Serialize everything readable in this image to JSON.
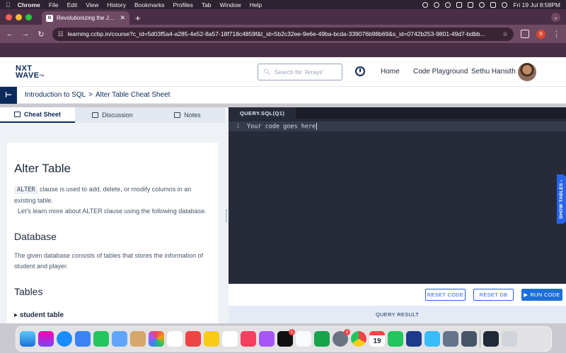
{
  "menubar": {
    "app": "Chrome",
    "items": [
      "File",
      "Edit",
      "View",
      "History",
      "Bookmarks",
      "Profiles",
      "Tab",
      "Window",
      "Help"
    ],
    "clock": "Fri 19 Jul  8:58PM"
  },
  "browser": {
    "tab_title": "Revolutionizing the Job Mark",
    "url": "learning.ccbp.in/course?c_id=5d03f5a4-a285-4e52-8a57-18f718c4859f&t_id=5b2c32ee-9e6e-49ba-bcda-339076b98b69&s_id=0742b253-9801-49d7-bdbb...",
    "profile_initial": "S"
  },
  "header": {
    "logo_line1": "NXT",
    "logo_line2": "WAVE",
    "logo_tm": "TM",
    "search_placeholder": "Search for 'Arrays'",
    "nav_home": "Home",
    "nav_playground": "Code Playground",
    "user_name": "Sethu Hansith"
  },
  "breadcrumb": {
    "course": "Introduction to SQL",
    "separator": ">",
    "page": "Alter Table Cheat Sheet"
  },
  "panel_tabs": [
    {
      "label": "Cheat Sheet",
      "icon": "book-icon"
    },
    {
      "label": "Discussion",
      "icon": "chat-icon"
    },
    {
      "label": "Notes",
      "icon": "notes-icon"
    }
  ],
  "content": {
    "title": "Alter Table",
    "intro_code": "ALTER",
    "intro_text": " clause is used to add, delete, or modify columns in an existing table.",
    "intro_text2": "Let's learn more about ALTER clause using the following database.",
    "db_heading": "Database",
    "db_text": "The given database consists of tables that stores the information of student and player.",
    "tables_heading": "Tables",
    "student_table": "▸ student table"
  },
  "editor": {
    "tab_label": "QUERY.SQL(Q1)",
    "line_number": "1",
    "placeholder_code": "Your code goes here",
    "show_tables": "SHOW TABLES ‹"
  },
  "actions": {
    "reset_code": "RESET CODE",
    "reset_db": "RESET DB",
    "run_code": "RUN CODE",
    "run_icon": "▶",
    "query_result": "QUERY RESULT"
  },
  "dock": {
    "calendar_day": "19",
    "badge_tv": "1",
    "badge_settings": "2"
  },
  "colors": {
    "navy": "#0b2a5b",
    "editor_bg": "#272b39",
    "accent_blue": "#2563eb"
  }
}
